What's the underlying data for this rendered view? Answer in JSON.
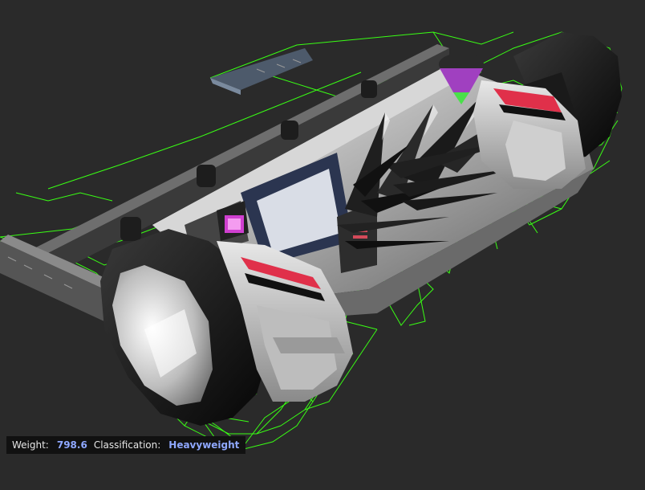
{
  "status": {
    "weight_label": "Weight:",
    "weight_value": "798.6",
    "classification_label": "Classification:",
    "classification_value": "Heavyweight"
  },
  "colors": {
    "background": "#2a2a2a",
    "wireframe": "#39ff14",
    "value_text": "#8fa8ff",
    "label_text": "#e6e6e6",
    "accent_red": "#e0304a",
    "accent_magenta": "#d040d0"
  }
}
